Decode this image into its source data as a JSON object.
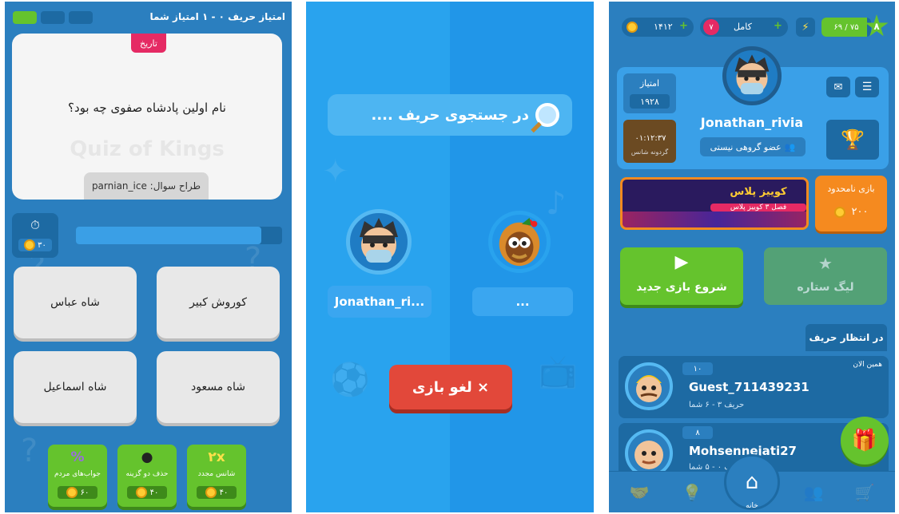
{
  "screen_quiz": {
    "score_text": "امتیاز حریف ۰ - ۱ امتیاز شما",
    "category": "تاریخ",
    "question": "نام اولین پادشاه صفوی چه بود؟",
    "watermark": "Quiz of Kings",
    "designer": "طراح سوال: parnian_ice",
    "timer_cost": "۳۰",
    "timer_progress": 0.9,
    "answers": [
      {
        "text": "کوروش کبیر"
      },
      {
        "text": "شاه عباس"
      },
      {
        "text": "شاه مسعود"
      },
      {
        "text": "شاه اسماعیل"
      }
    ],
    "powerups": [
      {
        "label": "شانس مجدد",
        "glyph": "۲x",
        "cost": "۴۰"
      },
      {
        "label": "حذف دو گزینه",
        "glyph": "●",
        "cost": "۴۰"
      },
      {
        "label": "جواب‌های مردم",
        "glyph": "%",
        "cost": "۶۰"
      }
    ]
  },
  "screen_search": {
    "search_text": "در جستجوی حریف ....",
    "player_name": "Jonathan_ri...",
    "opponent_name": "...",
    "cancel_label": "× لغو بازی"
  },
  "screen_home": {
    "level": "۸",
    "xp": "۶۹ / ۷۵",
    "energy_label": "کامل",
    "hearts": "۷",
    "coins": "۱۴۱۲",
    "username": "Jonathan_rivia",
    "group_status": "عضو گروهی نیستی",
    "score_label": "امتیاز",
    "score_value": "۱۹۲۸",
    "wheel_timer": "۰۱:۱۲:۳۷",
    "wheel_label": "گردونه شانس",
    "unlimited_label": "بازی نامحدود",
    "unlimited_cost": "۲۰۰",
    "banner_title": "کوییز پلاس",
    "banner_sub": "فصل ۳ کوییز پلاس",
    "new_game_label": "شروع بازی جدید",
    "star_league_label": "لیگ ستاره",
    "waiting_label": "در انتظار حریف",
    "games": [
      {
        "badge": "۱۰",
        "time": "همین الان",
        "name": "Guest_711439231",
        "score": "حریف ۳ - ۶ شما"
      },
      {
        "badge": "۸",
        "time": "",
        "name": "Mohsennejati27",
        "score": "حریف ۰ - ۵ شما"
      }
    ],
    "nav_home": "خانه",
    "colors": {
      "accent_green": "#65c32d",
      "accent_orange": "#f58a1f",
      "danger_red": "#e2483a"
    }
  }
}
